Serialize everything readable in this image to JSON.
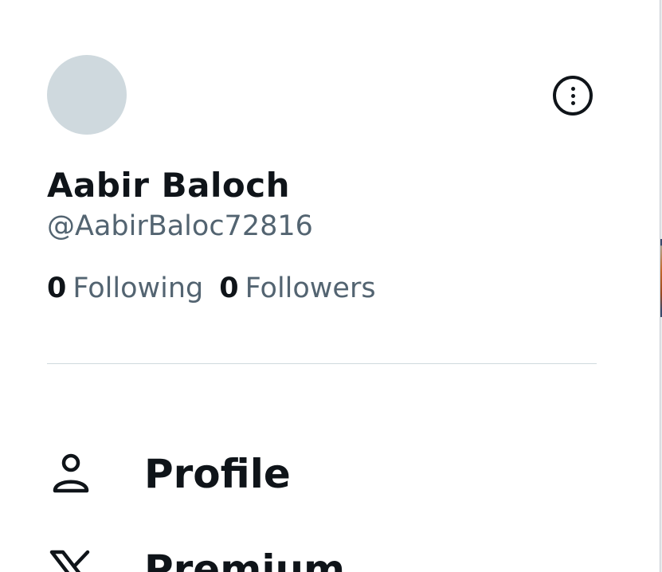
{
  "profile": {
    "display_name": "Aabir Baloch",
    "handle": "@AabirBaloc72816",
    "following_count": "0",
    "following_label": "Following",
    "followers_count": "0",
    "followers_label": "Followers"
  },
  "colors": {
    "text_primary": "#0f1419",
    "text_secondary": "#536471",
    "avatar_placeholder": "#cfd9de",
    "divider": "#cfd9de"
  },
  "nav": {
    "items": [
      {
        "label": "Profile",
        "icon": "person-icon"
      },
      {
        "label": "Premium",
        "icon": "x-logo-icon"
      }
    ]
  },
  "icons": {
    "more": "more-options-icon"
  }
}
